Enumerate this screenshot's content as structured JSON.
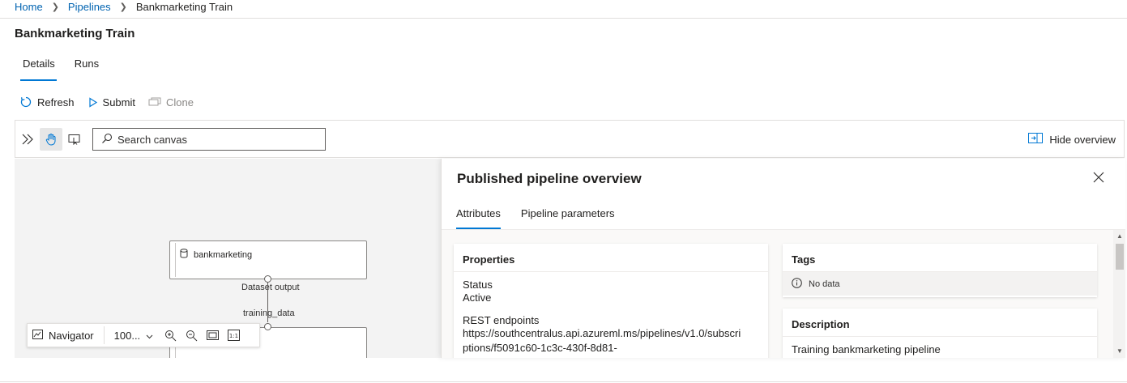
{
  "breadcrumb": {
    "items": [
      "Home",
      "Pipelines"
    ],
    "current": "Bankmarketing Train"
  },
  "page": {
    "title": "Bankmarketing Train"
  },
  "tabs": [
    {
      "label": "Details",
      "active": true
    },
    {
      "label": "Runs",
      "active": false
    }
  ],
  "toolbar": {
    "refresh": "Refresh",
    "submit": "Submit",
    "clone": "Clone"
  },
  "canvas_toolbar": {
    "search_placeholder": "Search canvas",
    "hide_overview": "Hide overview"
  },
  "canvas": {
    "nodes": [
      {
        "label": "bankmarketing"
      },
      {
        "label": ""
      }
    ],
    "output_label": "Dataset output",
    "input_label": "training_data"
  },
  "navigator": {
    "label": "Navigator",
    "zoom": "100..."
  },
  "overview": {
    "title": "Published pipeline overview",
    "tabs": [
      {
        "label": "Attributes",
        "active": true
      },
      {
        "label": "Pipeline parameters",
        "active": false
      }
    ],
    "properties": {
      "heading": "Properties",
      "status_label": "Status",
      "status_value": "Active",
      "endpoints_label": "REST endpoints",
      "endpoint_line1": "https://southcentralus.api.azureml.ms/pipelines/v1.0/subscri",
      "endpoint_line2": "ptions/f5091c60-1c3c-430f-8d81-"
    },
    "tags": {
      "heading": "Tags",
      "empty": "No data"
    },
    "description": {
      "heading": "Description",
      "text": "Training bankmarketing pipeline"
    }
  },
  "colors": {
    "accent": "#0078d4",
    "link": "#0063b1",
    "canvas_bg": "#f3f3f3"
  }
}
